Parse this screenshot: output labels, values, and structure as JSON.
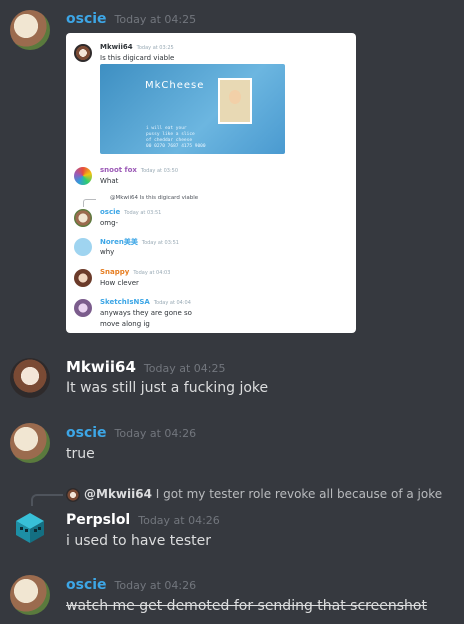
{
  "messages": [
    {
      "author": "oscie",
      "author_color": "#3da6e6",
      "timestamp": "Today at 04:25",
      "avatar": "oscie-avatar",
      "attachment": {
        "author": "Mkwii64",
        "timestamp": "Today at 03:25",
        "text": "Is this digicard viable",
        "card": {
          "title": "MkCheese",
          "lines": [
            "i will eat your",
            "pussy like a slice",
            "of cheddar cheese",
            "00 0270 7687 4175 9000"
          ]
        },
        "messages": [
          {
            "author": "snoot fox",
            "author_color": "#9b59b6",
            "timestamp": "Today at 03:50",
            "text": "What"
          },
          {
            "reply_to": "@Mkwii64 Is this digicard viable",
            "author": "oscie",
            "author_color": "#3da6e6",
            "timestamp": "Today at 03:51",
            "text": "omg-"
          },
          {
            "author": "Noren美美",
            "author_color": "#3da6e6",
            "timestamp": "Today at 03:51",
            "text": "why"
          },
          {
            "author": "Snappy",
            "author_color": "#e67e22",
            "timestamp": "Today at 04:03",
            "text": "How clever"
          },
          {
            "author": "SketchIsNSA",
            "author_color": "#3da6e6",
            "timestamp": "Today at 04:04",
            "text": "anyways they are gone so",
            "text2": "move along ig"
          }
        ]
      }
    },
    {
      "author": "Mkwii64",
      "author_color": "#ffffff",
      "timestamp": "Today at 04:25",
      "text": "It was still just a fucking joke"
    },
    {
      "author": "oscie",
      "author_color": "#3da6e6",
      "timestamp": "Today at 04:26",
      "text": "true"
    },
    {
      "reply_mention": "@Mkwii64",
      "reply_text": "I got my tester role revoke all because of a joke",
      "author": "Perpslol",
      "author_color": "#ffffff",
      "timestamp": "Today at 04:26",
      "text": "i used to have tester"
    },
    {
      "author": "oscie",
      "author_color": "#3da6e6",
      "timestamp": "Today at 04:26",
      "text": "watch me get demoted for sending that screenshot",
      "strikethrough": true
    }
  ]
}
